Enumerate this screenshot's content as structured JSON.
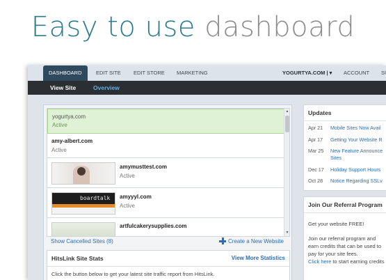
{
  "headline": {
    "part1": "Easy to use",
    "part2": "dashboard"
  },
  "topnav": {
    "items": [
      "DASHBOARD",
      "EDIT SITE",
      "EDIT STORE",
      "MARKETING"
    ],
    "site_selector": "YOGURTYA.COM | ▾",
    "account": "ACCOUNT",
    "cutoff": "SU"
  },
  "subnav": {
    "view_site": "View Site",
    "overview": "Overview"
  },
  "sites": [
    {
      "name": "yogurtya.com",
      "status": "Active"
    },
    {
      "name": "amy-albert.com",
      "status": "Active"
    },
    {
      "name": "amymusttest.com",
      "status": "Active"
    },
    {
      "name": "amyyyl.com",
      "status": "Active"
    },
    {
      "name": "artfulcakerysupplies.com",
      "status": ""
    }
  ],
  "thumb_text": "boardtalk",
  "site_links": {
    "cancelled": "Show Cancelled Sites (8)",
    "create": "Create a New Website"
  },
  "hitslink": {
    "title": "HitsLink Site Stats",
    "more": "View More Statistics",
    "description": "Click the button below to get your latest site traffic report from HitsLink."
  },
  "updates": {
    "title": "Updates",
    "items": [
      {
        "date": "Apr 21",
        "text": "Mobile Sites Now Avail"
      },
      {
        "date": "Apr 17",
        "text": "Getting Your Website R"
      },
      {
        "date": "Mar 25",
        "text": "New Feature Announce",
        "text2": "Sites"
      },
      {
        "date": "Dec 17",
        "text": "Holiday Support Hours"
      },
      {
        "date": "Oct 28",
        "text": "Notice Regarding SSLv"
      }
    ]
  },
  "referral": {
    "title": "Join Our Referral Program",
    "line1": "Get your website FREE!",
    "line2": "Join our referral program and",
    "line3": "earn credits that can be used to",
    "line4": "pay for your site fees.",
    "link": "Click here",
    "line5_rest": " to start earning credits"
  },
  "colors": {
    "teal": "#2d7b8c",
    "gray": "#8c8c8c",
    "link": "#2a6db5",
    "nav_active": "#2f4a5f",
    "subnav": "#2b2f34",
    "selected_row": "#dff2d5"
  }
}
